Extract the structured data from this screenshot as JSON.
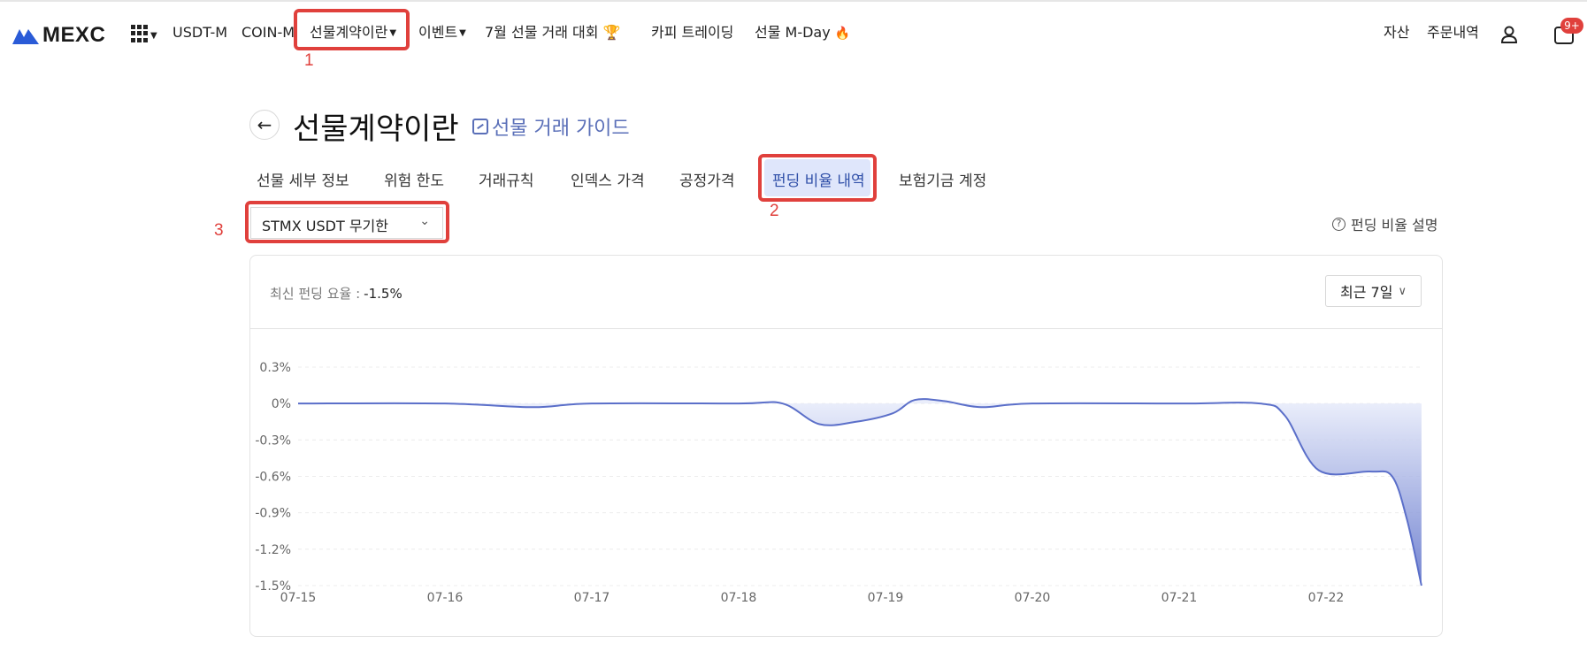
{
  "nav": {
    "logo_text": "MEXC",
    "items": [
      {
        "label": "USDT-M"
      },
      {
        "label": "COIN-M"
      },
      {
        "label": "선물계약이란"
      },
      {
        "label": "이벤트"
      },
      {
        "label": "7월 선물 거래 대회"
      },
      {
        "label": "카피 트레이딩"
      },
      {
        "label": "선물 M-Day"
      }
    ],
    "right": {
      "assets": "자산",
      "orders": "주문내역",
      "badge": "9+"
    }
  },
  "annotations": [
    "1",
    "2",
    "3"
  ],
  "page": {
    "title": "선물계약이란",
    "guide_link": "선물 거래 가이드",
    "tabs": [
      {
        "label": "선물 세부 정보"
      },
      {
        "label": "위험 한도"
      },
      {
        "label": "거래규칙"
      },
      {
        "label": "인덱스 가격"
      },
      {
        "label": "공정가격"
      },
      {
        "label": "펀딩 비율 내역",
        "active": true
      },
      {
        "label": "보험기금 계정"
      }
    ],
    "contract_select": "STMX USDT 무기한",
    "funding_help": "펀딩 비율 설명",
    "latest_label": "최신 펀딩 요율 :",
    "latest_value": "-1.5%",
    "range_button": "최근 7일"
  },
  "colors": {
    "accent": "#5a6fb8",
    "line": "#5b6fc9",
    "annotation": "#e0403c",
    "active_tab_bg": "#dfe6fb"
  },
  "chart_data": {
    "type": "area",
    "title": "",
    "xlabel": "",
    "ylabel": "",
    "y_ticks": [
      "0.3%",
      "0%",
      "-0.3%",
      "-0.6%",
      "-0.9%",
      "-1.2%",
      "-1.5%"
    ],
    "x_ticks": [
      "07-15",
      "07-16",
      "07-17",
      "07-18",
      "07-19",
      "07-20",
      "07-21",
      "07-22"
    ],
    "ylim": [
      -1.5,
      0.3
    ],
    "grid": true,
    "series": [
      {
        "values_percent": [
          [
            0.0,
            0.0
          ],
          [
            1.0,
            0.0
          ],
          [
            1.6,
            -0.03
          ],
          [
            2.0,
            0.0
          ],
          [
            3.0,
            0.0
          ],
          [
            3.3,
            0.0
          ],
          [
            3.55,
            -0.17
          ],
          [
            3.8,
            -0.15
          ],
          [
            4.05,
            -0.08
          ],
          [
            4.2,
            0.03
          ],
          [
            4.4,
            0.02
          ],
          [
            4.65,
            -0.03
          ],
          [
            5.0,
            0.0
          ],
          [
            6.0,
            0.0
          ],
          [
            6.55,
            0.0
          ],
          [
            6.72,
            -0.1
          ],
          [
            6.95,
            -0.55
          ],
          [
            7.3,
            -0.56
          ],
          [
            7.45,
            -0.6
          ],
          [
            7.55,
            -0.95
          ],
          [
            7.65,
            -1.5
          ]
        ]
      }
    ]
  }
}
